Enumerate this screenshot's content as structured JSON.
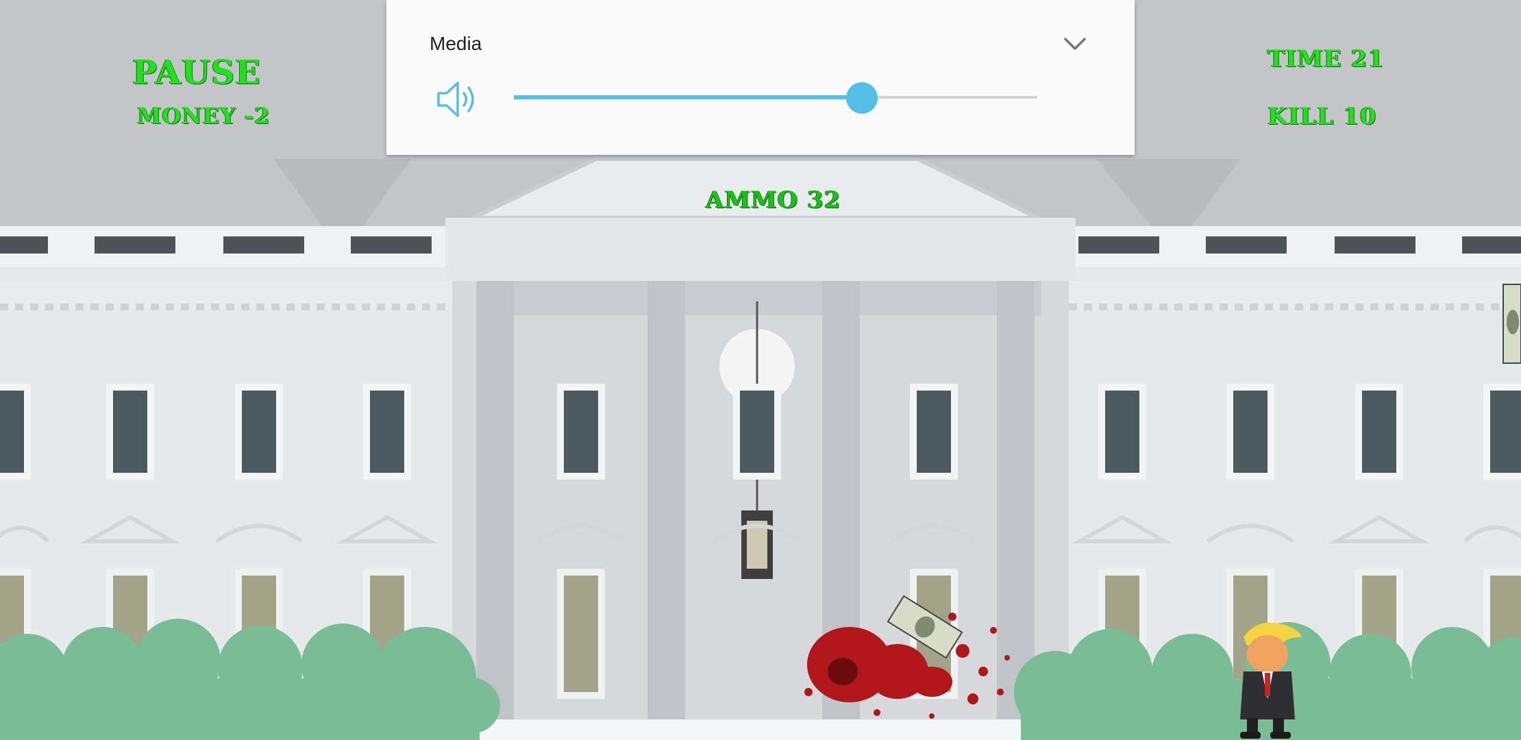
{
  "hud": {
    "pause_label": "PAUSE",
    "money_label": "MONEY -2",
    "time_label": "TIME 21",
    "kill_label": "KILL 10",
    "ammo_label": "AMMO 32",
    "text_color": "#22e01e"
  },
  "volume_panel": {
    "title": "Media",
    "level": 0.665,
    "accent_color": "#55bee6",
    "icons": [
      "speaker-icon",
      "chevron-down-icon"
    ]
  },
  "scene": {
    "background": "white-house",
    "sprites": [
      "dollar-bill",
      "blood-splatter",
      "trump-character",
      "lamp"
    ]
  }
}
